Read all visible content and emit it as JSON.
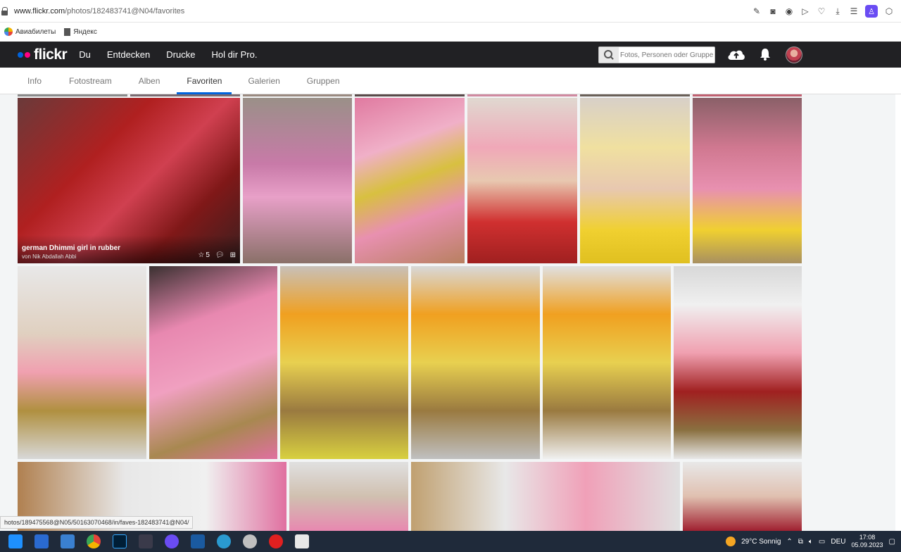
{
  "browser": {
    "url_host": "www.flickr.com",
    "url_path": "/photos/182483741@N04/favorites",
    "bookmarks": [
      {
        "label": "Авиабилеты",
        "icon": "travel-icon"
      },
      {
        "label": "Яндекс",
        "icon": "bookmark-page-icon"
      }
    ],
    "status_link": "hotos/189475568@N05/50163070468/in/faves-182483741@N04/"
  },
  "flickr": {
    "logo": "flickr",
    "nav": [
      "Du",
      "Entdecken",
      "Drucke",
      "Hol dir Pro."
    ],
    "search_placeholder": "Fotos, Personen oder Gruppen",
    "colors": {
      "blue": "#0063dc",
      "pink": "#ff0084",
      "navbar": "#212124"
    }
  },
  "tabs": [
    {
      "label": "Info",
      "active": false
    },
    {
      "label": "Fotostream",
      "active": false
    },
    {
      "label": "Alben",
      "active": false
    },
    {
      "label": "Favoriten",
      "active": true
    },
    {
      "label": "Galerien",
      "active": false
    },
    {
      "label": "Gruppen",
      "active": false
    }
  ],
  "featured_photo": {
    "title": "german Dhimmi girl in rubber",
    "author": "von Nik Abdallah Abbi",
    "fave_count": "5"
  },
  "taskbar": {
    "weather": "29°C  Sonnig",
    "language": "DEU",
    "time": "17:08",
    "date": "05.09.2023"
  }
}
